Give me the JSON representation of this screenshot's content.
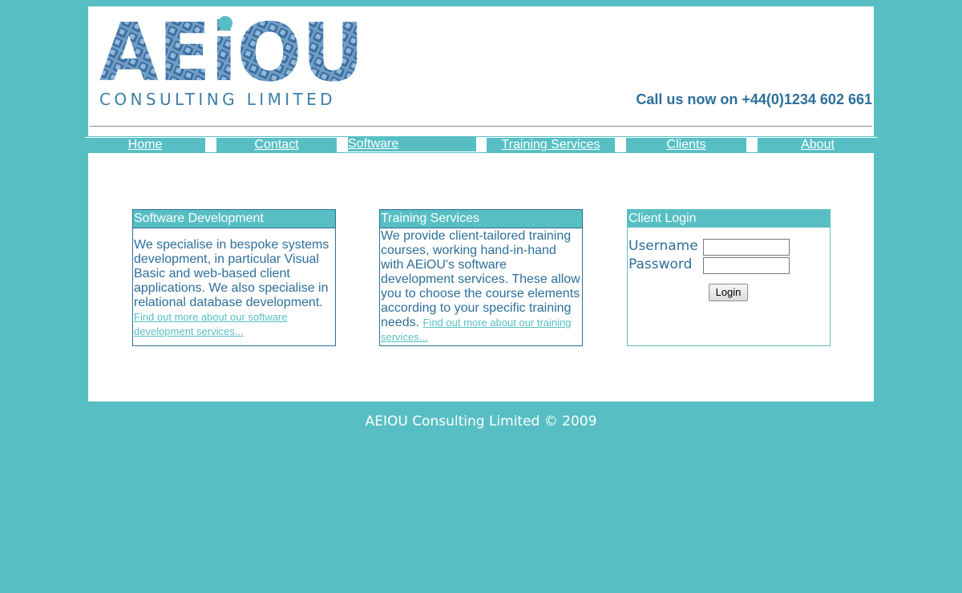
{
  "brand": {
    "logo_text": "AEiOU",
    "logo_subtitle": "CONSULTING LIMITED",
    "phone_text": "Call us now on +44(0)1234 602 661"
  },
  "nav": {
    "items": [
      {
        "label": "Home"
      },
      {
        "label": "Contact"
      },
      {
        "label": "Software"
      },
      {
        "label": "Training Services"
      },
      {
        "label": "Clients"
      },
      {
        "label": "About"
      }
    ]
  },
  "software_box": {
    "title": "Software Development",
    "body": "We specialise in bespoke systems development, in particular Visual Basic and web-based client applications. We also specialise in relational database development.",
    "link": "Find out more about our software development services..."
  },
  "training_box": {
    "title": "Training Services",
    "body": "We provide client-tailored training courses, working hand-in-hand with AEiOU's software development services. These allow you to choose the course elements according to your specific training needs.",
    "link": "Find out more about our training services..."
  },
  "login_box": {
    "title": "Client Login",
    "username_label": "Username",
    "password_label": "Password",
    "username_value": "",
    "password_value": "",
    "button_label": "Login"
  },
  "footer": {
    "text": "AEIOU Consulting Limited © 2009"
  },
  "colors": {
    "background": "#57bfc4",
    "brand_blue": "#2d6f99",
    "white": "#ffffff"
  }
}
